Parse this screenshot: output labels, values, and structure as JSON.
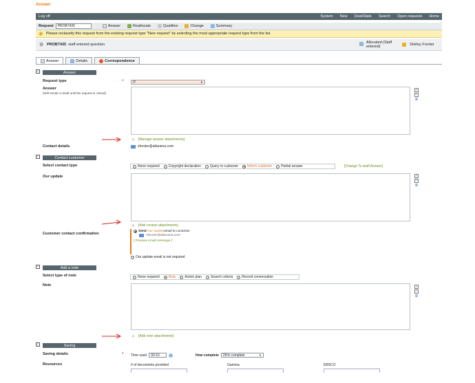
{
  "brand": "Answer",
  "topnav": {
    "logoff": "Log off",
    "items": [
      "System",
      "New",
      "DeskStats",
      "Search",
      "Open requests",
      "Home"
    ]
  },
  "request_bar": {
    "label": "Request",
    "request_value": "PROB7435",
    "tools": [
      "Answer",
      "Reallocate",
      "Qualities",
      "Change",
      "Summary"
    ]
  },
  "warning": "Please reclassify this request from the existing request type \"New request\" by selecting the most appropriate request type from the list.",
  "problem": {
    "id": "PROB7435",
    "summary": "staff entered question",
    "allocated": [
      "Allocated (Staff",
      "entered)"
    ],
    "owner": "Shirley Forster"
  },
  "tabs": [
    "Answer",
    "Details",
    "Correspondence"
  ],
  "answer_section": {
    "title": "Answer",
    "request_type_label": "Request type",
    "request_type_value": "IT",
    "answer_label": "Answer",
    "answer_note": "(Will remain a Draft until the request is closed)",
    "attach_link": "[Manage answer attachments]",
    "contact_label": "Contact details",
    "contact_email": "sforster@altarama.com"
  },
  "contact_section": {
    "title": "Contact customer",
    "select_label": "Select contact type",
    "options": [
      "None required",
      "Copyright declaration",
      "Query to customer",
      "Inform customer",
      "Partial answer"
    ],
    "selected": "Inform customer",
    "change_link": "[Change To draft Answer]",
    "update_label": "Our update",
    "attach_link": "[Add contact attachments]",
    "confirm_label": "Customer contact confirmation",
    "send_bold": "Send",
    "send_italic_orange": "Our update",
    "send_rest": " email to customer",
    "to_email": "sforster@altarama.com",
    "preview_link": "[ Preview email message ]",
    "no_send": "Our update email is not required"
  },
  "note_section": {
    "title": "Add a note",
    "select_label": "Select type of note",
    "options": [
      "None required",
      "Note",
      "Action plan",
      "Search criteria",
      "Record conversation"
    ],
    "selected": "Note",
    "note_label": "Note",
    "attach_link": "[Add note attachments]"
  },
  "saving_section": {
    "title": "Saving",
    "details_label": "Saving details",
    "time_used_label": "Time used",
    "time_used_value": "00:10",
    "how_complete_label": "How complete",
    "how_complete_value": "25% complete",
    "resources_label": "Resources",
    "resource_cols": [
      "# of documents provided",
      "Gamma",
      "EBSCO"
    ]
  },
  "colors": {
    "accent": "#e57c1b",
    "bar": "#56656c",
    "warning": "#fbf0b6"
  }
}
